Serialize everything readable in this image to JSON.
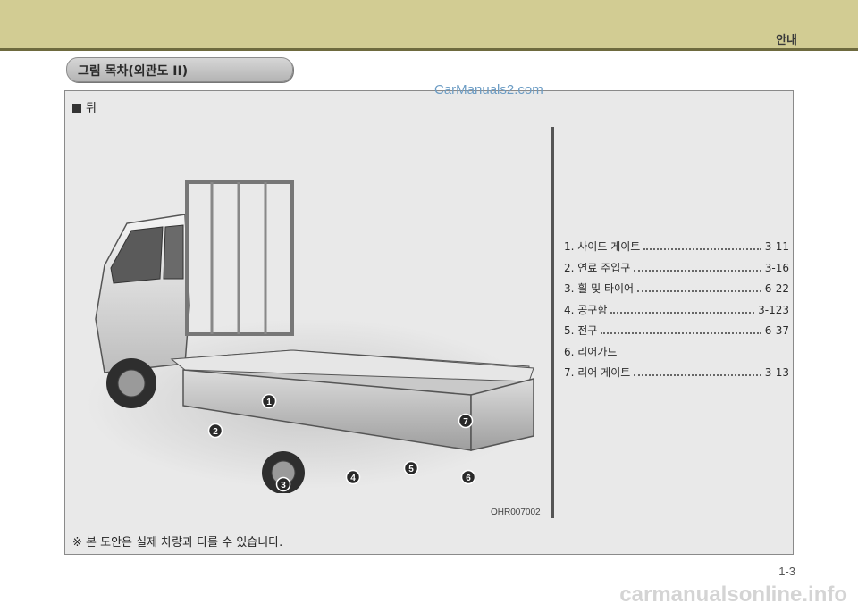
{
  "header": {
    "section": "안내"
  },
  "title": "그림 목차(외관도 II)",
  "watermark": "CarManuals2.com",
  "view_label": "뒤",
  "image_code": "OHR007002",
  "items": [
    {
      "number": "1",
      "label": "1. 사이드 게이트",
      "page": "3-11"
    },
    {
      "number": "2",
      "label": "2. 연료 주입구",
      "page": "3-16"
    },
    {
      "number": "3",
      "label": "3. 휠 및 타이어",
      "page": "6-22"
    },
    {
      "number": "4",
      "label": "4. 공구함",
      "page": "3-123"
    },
    {
      "number": "5",
      "label": "5. 전구",
      "page": "6-37"
    },
    {
      "number": "6",
      "label": "6. 리어가드",
      "page": ""
    },
    {
      "number": "7",
      "label": "7. 리어 게이트",
      "page": "3-13"
    }
  ],
  "note": "※ 본 도안은 실제 차량과 다를 수 있습니다.",
  "page_number": "1-3",
  "footer": "carmanualsonline.info",
  "colors": {
    "header_band": "#d2cc93",
    "header_line": "#6e6a3e",
    "panel_bg": "#e9e9e9",
    "watermark": "#6c9cc4"
  }
}
